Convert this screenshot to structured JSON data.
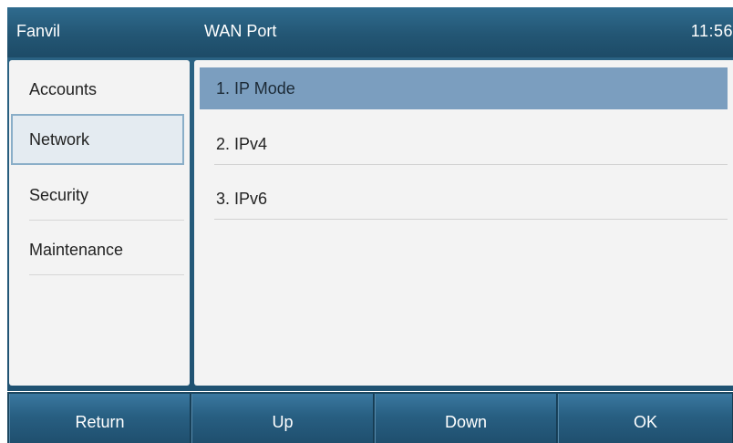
{
  "header": {
    "brand": "Fanvil",
    "title": "WAN Port",
    "clock": "11:56"
  },
  "sidebar": {
    "items": [
      {
        "label": "Accounts",
        "selected": false
      },
      {
        "label": "Network",
        "selected": true
      },
      {
        "label": "Security",
        "selected": false
      },
      {
        "label": "Maintenance",
        "selected": false
      }
    ]
  },
  "menu": {
    "items": [
      {
        "label": "1. IP Mode",
        "selected": true
      },
      {
        "label": "2. IPv4",
        "selected": false
      },
      {
        "label": "3. IPv6",
        "selected": false
      }
    ]
  },
  "softkeys": {
    "return": "Return",
    "up": "Up",
    "down": "Down",
    "ok": "OK"
  },
  "colors": {
    "header_bg": "#235674",
    "selection": "#7b9ebf",
    "panel_bg": "#f3f3f3",
    "softkey_bg": "#285f82"
  }
}
